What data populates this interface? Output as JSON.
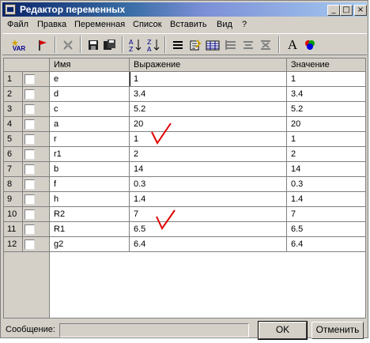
{
  "window": {
    "title": "Редактор переменных"
  },
  "titlebar_buttons": [
    "_",
    "□",
    "×"
  ],
  "menu": [
    "Файл",
    "Правка",
    "Переменная",
    "Список",
    "Вставить",
    "Вид",
    "?"
  ],
  "toolbar": {
    "var_label": "VAR",
    "font_label": "A",
    "icons": [
      "new-variable-icon",
      "flag-icon",
      "delete-icon",
      "save-icon",
      "save-all-icon",
      "sort-ascending-icon",
      "sort-descending-icon",
      "list-icon",
      "edit-icon",
      "table-icon",
      "insert-row-icon",
      "align-icon",
      "merge-icon",
      "font-icon",
      "color-icon"
    ]
  },
  "table": {
    "columns": [
      "Имя",
      "Выражение",
      "Значение"
    ],
    "rows": [
      {
        "num": "1",
        "name": "e",
        "expr": "1",
        "value": "1"
      },
      {
        "num": "2",
        "name": "d",
        "expr": "3.4",
        "value": "3.4"
      },
      {
        "num": "3",
        "name": "c",
        "expr": "5.2",
        "value": "5.2"
      },
      {
        "num": "4",
        "name": "a",
        "expr": "20",
        "value": "20"
      },
      {
        "num": "5",
        "name": "r",
        "expr": "1",
        "value": "1"
      },
      {
        "num": "6",
        "name": "r1",
        "expr": "2",
        "value": "2"
      },
      {
        "num": "7",
        "name": "b",
        "expr": "14",
        "value": "14"
      },
      {
        "num": "8",
        "name": "f",
        "expr": "0.3",
        "value": "0.3"
      },
      {
        "num": "9",
        "name": "h",
        "expr": "1.4",
        "value": "1.4"
      },
      {
        "num": "10",
        "name": "R2",
        "expr": "7",
        "value": "7"
      },
      {
        "num": "11",
        "name": "R1",
        "expr": "6.5",
        "value": "6.5"
      },
      {
        "num": "12",
        "name": "g2",
        "expr": "6.4",
        "value": "6.4"
      }
    ]
  },
  "status": {
    "label": "Сообщение:",
    "message": ""
  },
  "buttons": {
    "ok": "OK",
    "cancel": "Отменить"
  },
  "colors": {
    "title_start": "#0a246a",
    "title_end": "#a6caf0",
    "annotation": "#e00000",
    "face": "#d4d0c8"
  }
}
